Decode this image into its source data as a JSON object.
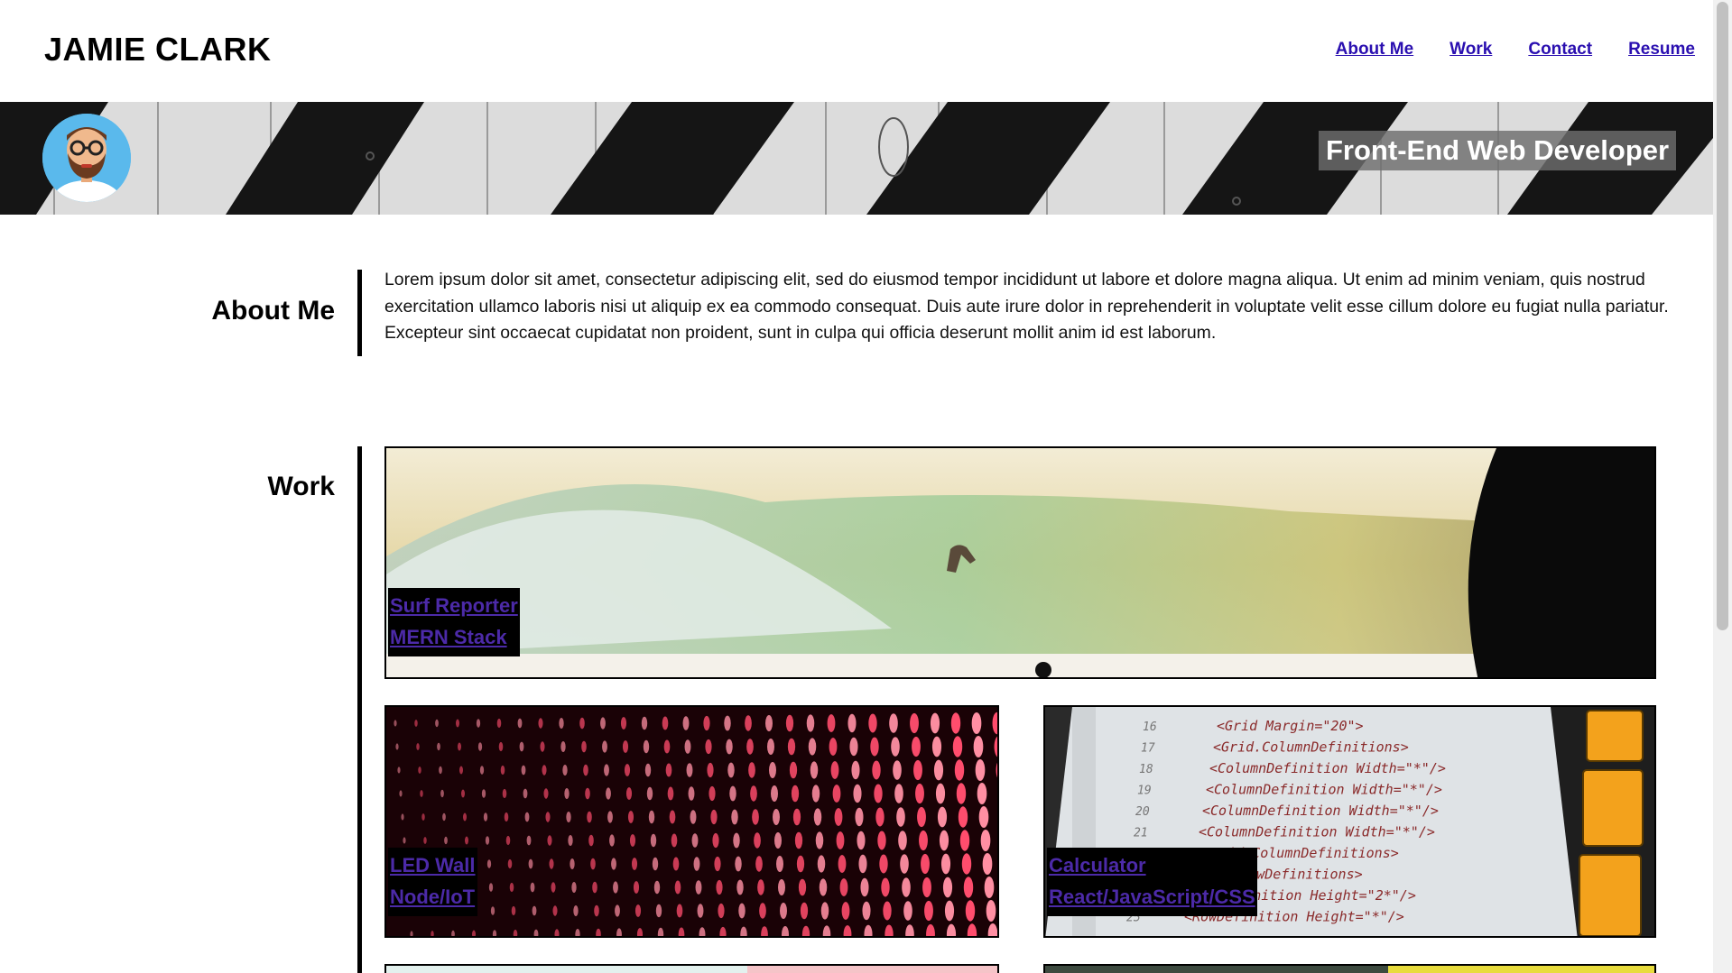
{
  "header": {
    "site_title": "JAMIE CLARK",
    "nav": [
      {
        "label": "About Me"
      },
      {
        "label": "Work"
      },
      {
        "label": "Contact"
      },
      {
        "label": "Resume"
      }
    ]
  },
  "banner": {
    "tagline": "Front-End Web Developer",
    "avatar_icon": "developer-avatar-icon"
  },
  "about": {
    "heading": "About Me",
    "text": "Lorem ipsum dolor sit amet, consectetur adipiscing elit, sed do eiusmod tempor incididunt ut labore et dolore magna aliqua. Ut enim ad minim veniam, quis nostrud exercitation ullamco laboris nisi ut aliquip ex ea commodo consequat. Duis aute irure dolor in reprehenderit in voluptate velit esse cillum dolore eu fugiat nulla pariatur. Excepteur sint occaecat cupidatat non proident, sunt in culpa qui officia deserunt mollit anim id est laborum."
  },
  "work": {
    "heading": "Work",
    "projects": [
      {
        "title": "Surf Reporter",
        "stack": "MERN Stack",
        "image": "surfer-wave-image"
      },
      {
        "title": "LED Wall",
        "stack": "Node/IoT",
        "image": "red-led-lights-image"
      },
      {
        "title": "Calculator",
        "stack": "React/JavaScript/CSS",
        "image": "code-editor-calculator-image"
      }
    ]
  },
  "colors": {
    "link": "#2a0fb0",
    "card_link": "#4c2aa8",
    "tagline_bg": "#6e6e6e",
    "avatar_bg": "#5ab9ec"
  }
}
